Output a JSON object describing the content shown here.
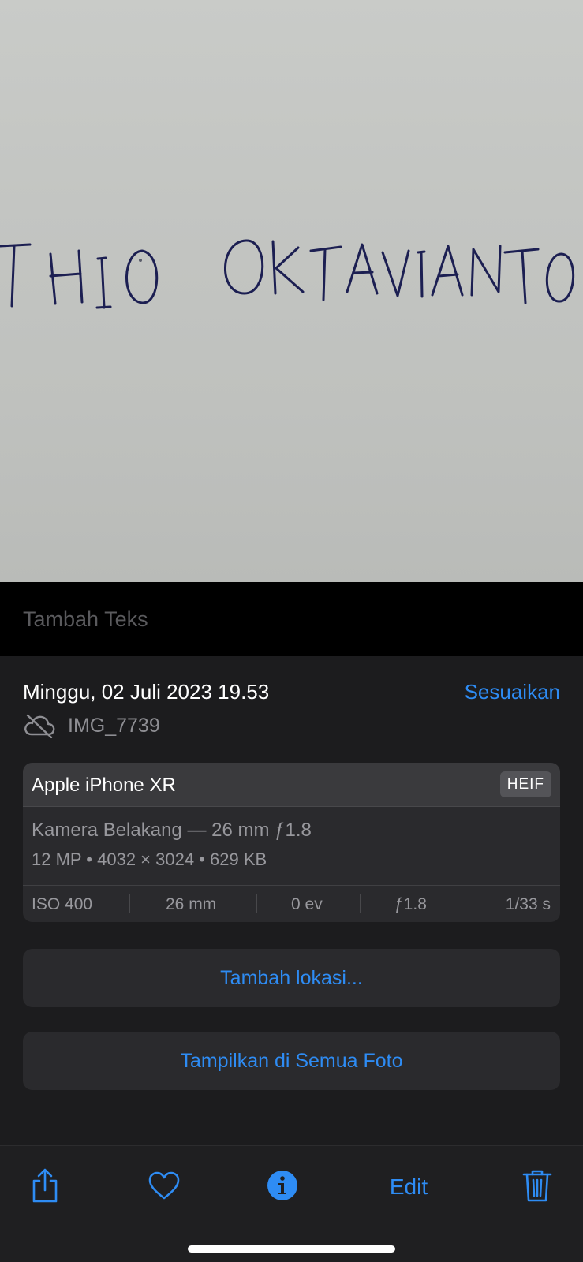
{
  "photo": {
    "handwritten_text": "THIO OKTAVIANTO",
    "ink_color": "#1c1f52"
  },
  "caption": {
    "placeholder": "Tambah Teks"
  },
  "info": {
    "date": "Minggu, 02 Juli 2023 19.53",
    "adjust_label": "Sesuaikan",
    "cloud_icon": "cloud-off-icon",
    "filename": "IMG_7739"
  },
  "exif": {
    "device": "Apple iPhone XR",
    "format": "HEIF",
    "lens": "Kamera Belakang — 26 mm ƒ1.8",
    "specs": "12 MP  •  4032 × 3024  •  629 KB",
    "iso": "ISO 400",
    "focal": "26 mm",
    "exposure": "0 ev",
    "aperture": "ƒ1.8",
    "shutter": "1/33 s"
  },
  "actions": {
    "add_location": "Tambah lokasi...",
    "show_all_photos": "Tampilkan di Semua Foto"
  },
  "toolbar": {
    "share_icon": "share-icon",
    "favorite_icon": "heart-icon",
    "info_icon": "info-icon",
    "edit_label": "Edit",
    "delete_icon": "trash-icon"
  },
  "colors": {
    "accent": "#2e8cf4",
    "panel": "#1c1c1e",
    "card": "#2a2a2d"
  }
}
